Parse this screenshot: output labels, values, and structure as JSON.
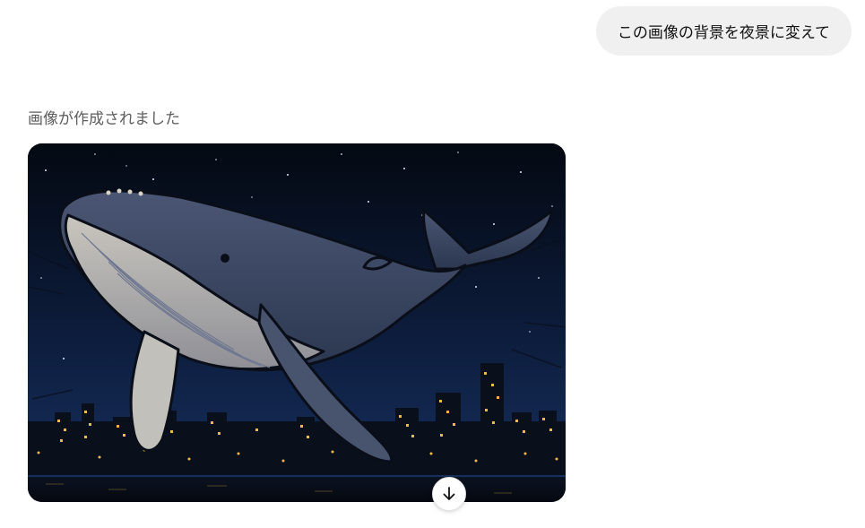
{
  "conversation": {
    "user_message": "この画像の背景を夜景に変えて",
    "assistant_status": "画像が作成されました"
  },
  "generated_image": {
    "subject": "whale-over-night-city",
    "download_icon": "arrow-down-icon"
  },
  "colors": {
    "user_bubble_bg": "#f0f0f0",
    "status_text": "#5d5d5d",
    "sky_top": "#050b17",
    "sky_bottom": "#142a55",
    "whale_body": "#3d4a66",
    "city_lights": "#f2b84b"
  }
}
